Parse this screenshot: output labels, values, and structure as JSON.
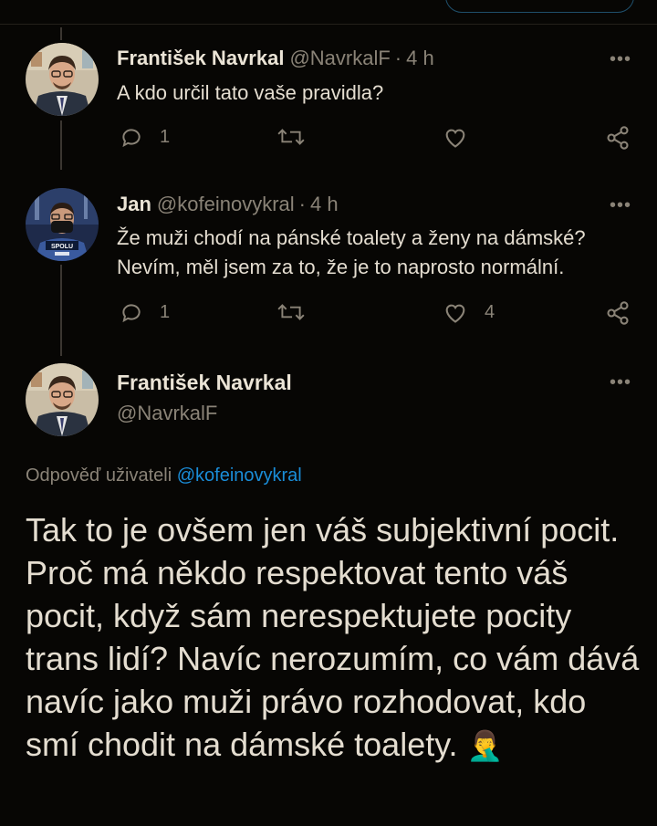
{
  "tweets": [
    {
      "name": "František Navrkal",
      "handle": "@NavrkalF",
      "time": "4 h",
      "text": "A kdo určil tato vaše pravidla?",
      "replies": "1",
      "retweets": "",
      "likes": ""
    },
    {
      "name": "Jan",
      "handle": "@kofeinovykral",
      "time": "4 h",
      "text_lines": [
        "Že muži chodí na pánské toalety a ženy na dámské?",
        "Nevím, měl jsem za to, že je to naprosto normální."
      ],
      "replies": "1",
      "retweets": "",
      "likes": "4",
      "avatar_badge": "SPOLU"
    }
  ],
  "main": {
    "name": "František Navrkal",
    "handle": "@NavrkalF",
    "reply_label": "Odpověď uživateli",
    "reply_mention": "@kofeinovykral",
    "text": "Tak to je ovšem jen váš subjektivní pocit. Proč má někdo respektovat tento váš pocit, když sám nerespektujete pocity trans lidí? Navíc nerozumím, co vám dává navíc jako muži právo rozhodovat, kdo smí chodit na dámské toalety.",
    "emoji": "🤦‍♂️"
  },
  "separator": "·",
  "more_glyph": "•••",
  "colors": {
    "background": "#070604",
    "text": "#e4ddd0",
    "muted": "#8a8377",
    "mention": "#1a8dd8",
    "thread_line": "#3b3631"
  },
  "icons": [
    "reply-icon",
    "retweet-icon",
    "like-icon",
    "share-icon",
    "more-icon"
  ]
}
